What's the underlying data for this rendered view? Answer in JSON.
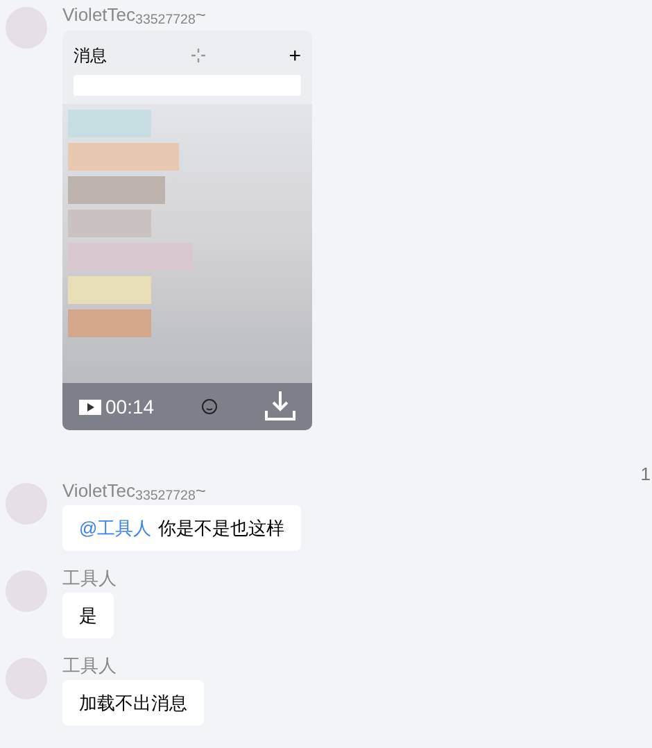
{
  "messages": [
    {
      "kind": "video",
      "sender": "VioletTec$_{33527728}$~",
      "video": {
        "title": "消息",
        "add": "+",
        "duration": "00:14"
      }
    },
    {
      "kind": "text",
      "sender": "VioletTec$_{33527728}$~",
      "mention": "@工具人",
      "text": "你是不是也这样"
    },
    {
      "kind": "text",
      "sender": "工具人",
      "text": "是"
    },
    {
      "kind": "text",
      "sender": "工具人",
      "text": "加载不出消息"
    }
  ],
  "side_marker": "1"
}
